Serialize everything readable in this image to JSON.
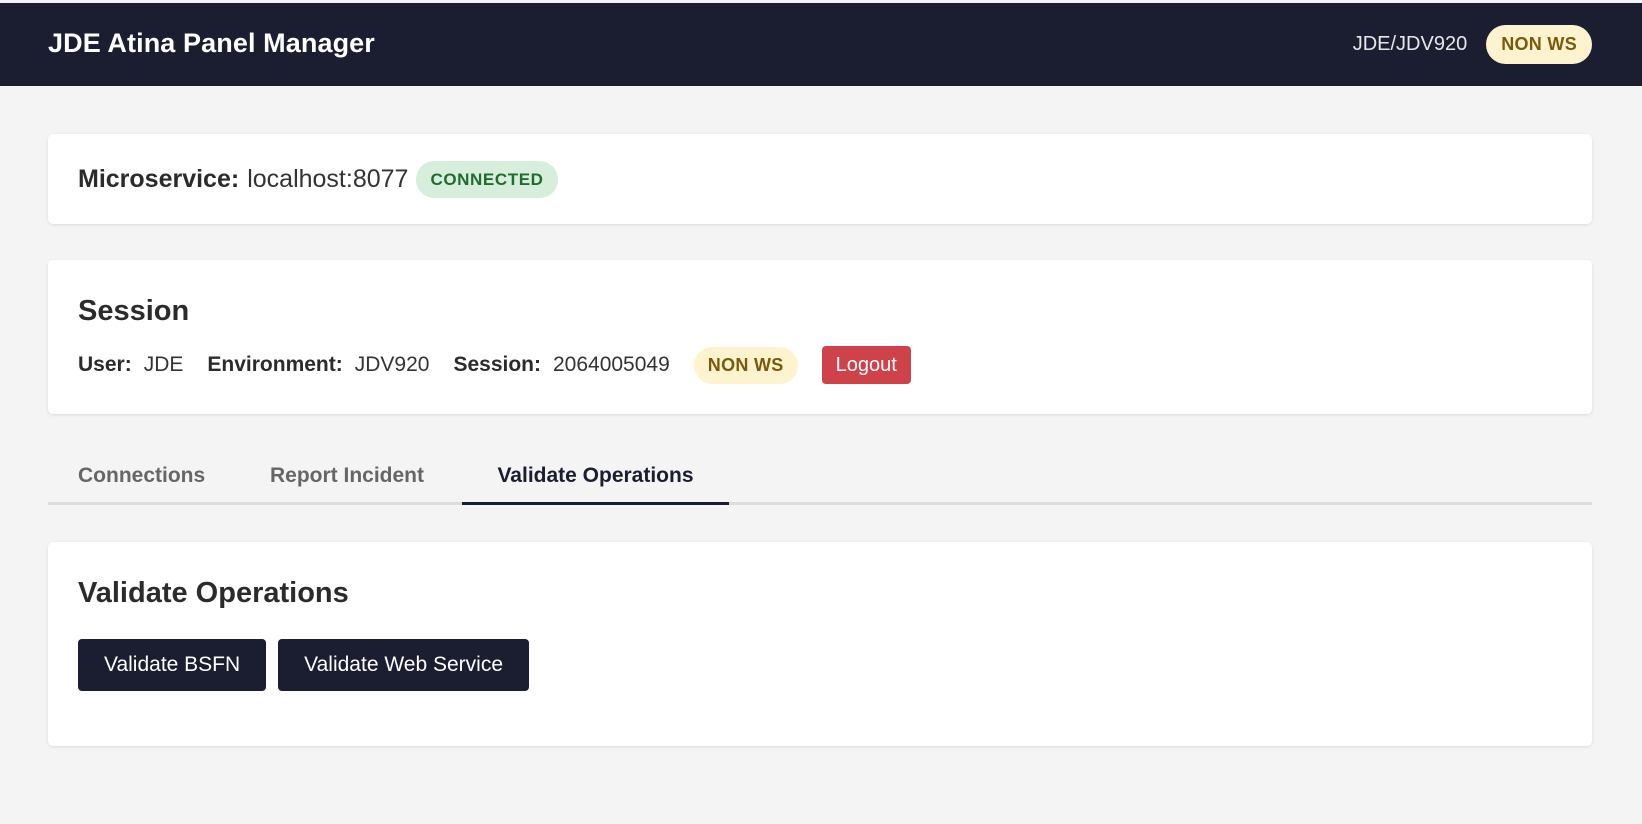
{
  "header": {
    "title": "JDE Atina Panel Manager",
    "env_label": "JDE/JDV920",
    "mode_badge": "NON WS"
  },
  "microservice": {
    "label": "Microservice:",
    "host": "localhost:8077",
    "status": "CONNECTED"
  },
  "session": {
    "title": "Session",
    "user_label": "User:",
    "user_value": "JDE",
    "environment_label": "Environment:",
    "environment_value": "JDV920",
    "session_label": "Session:",
    "session_value": "2064005049",
    "mode_badge": "NON WS",
    "logout_label": "Logout"
  },
  "tabs": [
    {
      "label": "Connections",
      "active": false
    },
    {
      "label": "Report Incident",
      "active": false
    },
    {
      "label": "Validate Operations",
      "active": true
    }
  ],
  "validate": {
    "title": "Validate Operations",
    "buttons": [
      {
        "label": "Validate BSFN"
      },
      {
        "label": "Validate Web Service"
      }
    ]
  },
  "colors": {
    "header_bg": "#1b1d30",
    "logout": "#d0424a",
    "connected_bg": "#d6eedb",
    "nonws_bg": "#fdf3cf"
  }
}
